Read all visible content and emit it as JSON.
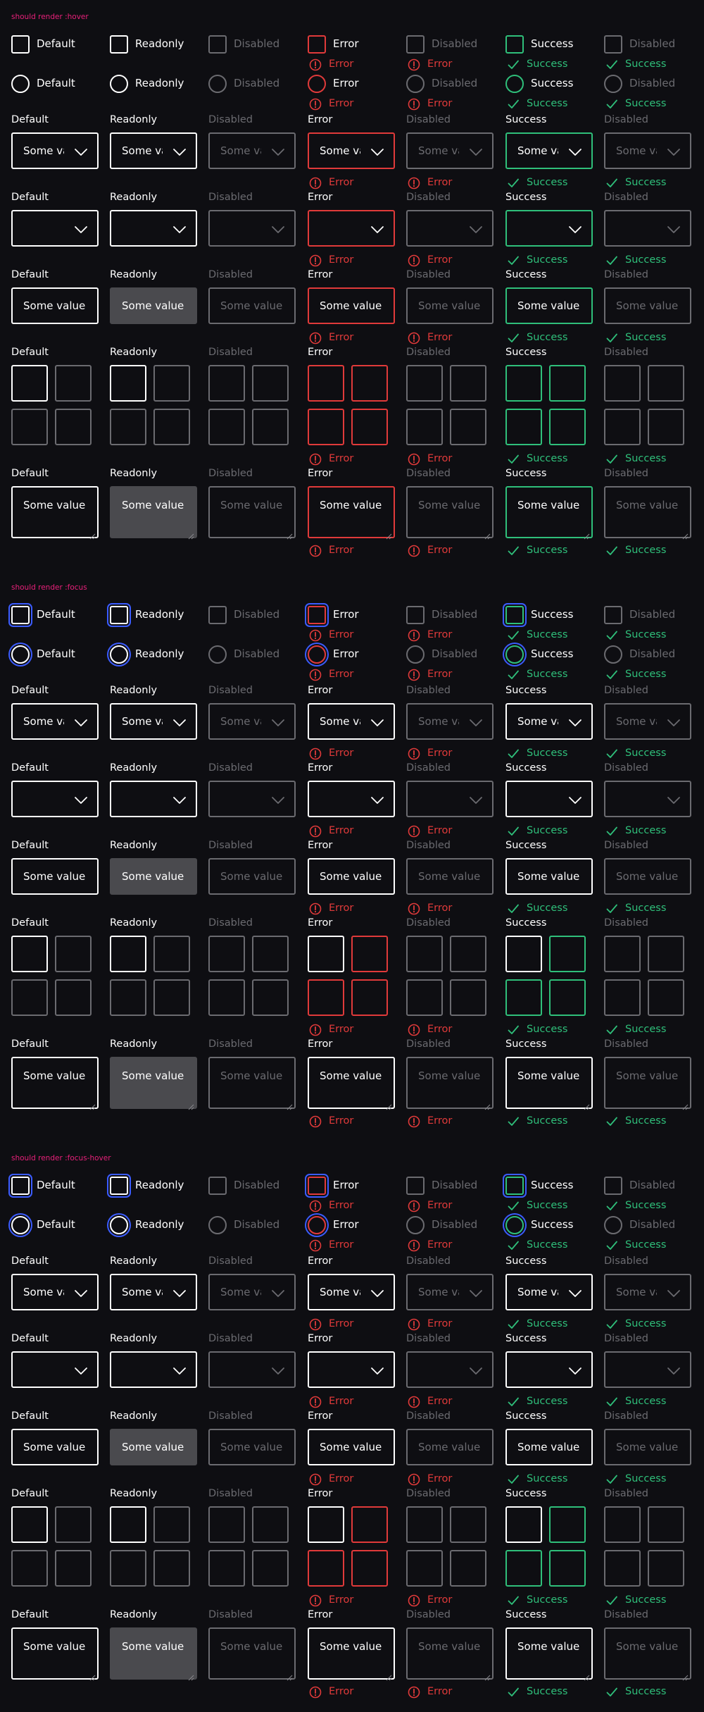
{
  "sections": [
    {
      "title": "should render :hover"
    },
    {
      "title": "should render :focus"
    },
    {
      "title": "should render :focus-hover"
    }
  ],
  "columns": [
    {
      "label": "Default",
      "value": "Some value",
      "select_value": "Some value",
      "message": ""
    },
    {
      "label": "Readonly",
      "value": "Some value",
      "select_value": "Some value",
      "message": ""
    },
    {
      "label": "Disabled",
      "value": "Some value",
      "select_value": "Some value",
      "message": ""
    },
    {
      "label": "Error",
      "value": "Some value",
      "select_value": "Some value",
      "message": "Error"
    },
    {
      "label": "Disabled",
      "value": "Some value",
      "select_value": "Some value",
      "message": "Error"
    },
    {
      "label": "Success",
      "value": "Some value",
      "select_value": "Some value",
      "message": "Success"
    },
    {
      "label": "Disabled",
      "value": "Some value",
      "select_value": "Some value",
      "message": "Success"
    }
  ],
  "colors": {
    "background": "#0e0e12",
    "section_label": "#e8207a",
    "default_border": "#ffffff",
    "muted_border": "#6b6b70",
    "disabled_text": "#6b6b70",
    "error": "#e03a3a",
    "success": "#2fbf7a",
    "focus_ring": "#3b5cff",
    "readonly_fill": "#4a4a4e"
  },
  "icons": {
    "select": "chevron-down-icon",
    "error": "error-circle-icon",
    "success": "checkmark-icon",
    "textarea": "resize-grip-icon"
  }
}
